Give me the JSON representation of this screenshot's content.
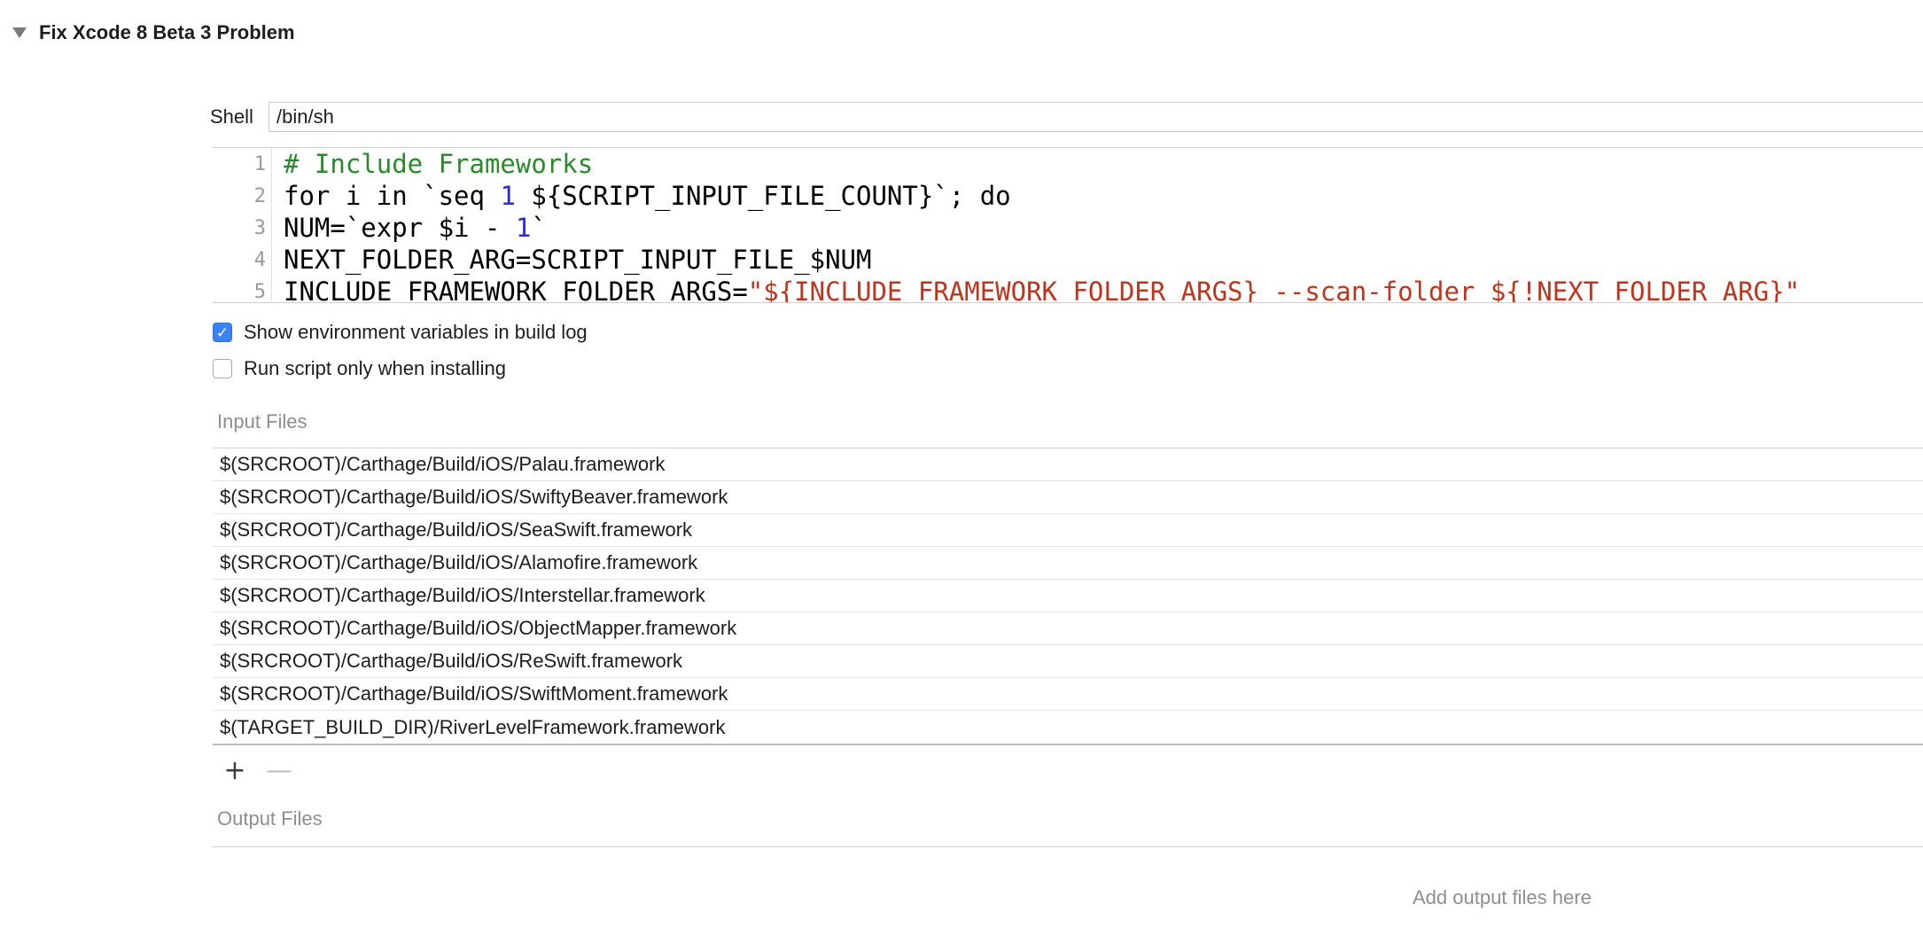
{
  "section": {
    "title": "Fix Xcode 8 Beta 3 Problem"
  },
  "shell": {
    "label": "Shell",
    "value": "/bin/sh"
  },
  "script": {
    "lines": [
      {
        "num": "1",
        "parts": [
          {
            "text": "# Include Frameworks",
            "style": "comment"
          }
        ]
      },
      {
        "num": "2",
        "parts": [
          {
            "text": "for i in `seq ",
            "style": "plain"
          },
          {
            "text": "1",
            "style": "num"
          },
          {
            "text": " ${SCRIPT_INPUT_FILE_COUNT}`; do",
            "style": "plain"
          }
        ]
      },
      {
        "num": "3",
        "parts": [
          {
            "text": "NUM=`expr $i - ",
            "style": "plain"
          },
          {
            "text": "1",
            "style": "num"
          },
          {
            "text": "`",
            "style": "plain"
          }
        ]
      },
      {
        "num": "4",
        "parts": [
          {
            "text": "NEXT_FOLDER_ARG=SCRIPT_INPUT_FILE_$NUM",
            "style": "plain"
          }
        ]
      },
      {
        "num": "5",
        "parts": [
          {
            "text": "INCLUDE_FRAMEWORK_FOLDER_ARGS=",
            "style": "plain"
          },
          {
            "text": "\"${INCLUDE_FRAMEWORK_FOLDER_ARGS} --scan-folder ${!NEXT_FOLDER_ARG}\"",
            "style": "str"
          }
        ]
      }
    ]
  },
  "options": {
    "show_env": {
      "label": "Show environment variables in build log",
      "checked": true
    },
    "run_only_installing": {
      "label": "Run script only when installing",
      "checked": false
    }
  },
  "input_files": {
    "title": "Input Files",
    "items": [
      "$(SRCROOT)/Carthage/Build/iOS/Palau.framework",
      "$(SRCROOT)/Carthage/Build/iOS/SwiftyBeaver.framework",
      "$(SRCROOT)/Carthage/Build/iOS/SeaSwift.framework",
      "$(SRCROOT)/Carthage/Build/iOS/Alamofire.framework",
      "$(SRCROOT)/Carthage/Build/iOS/Interstellar.framework",
      "$(SRCROOT)/Carthage/Build/iOS/ObjectMapper.framework",
      "$(SRCROOT)/Carthage/Build/iOS/ReSwift.framework",
      "$(SRCROOT)/Carthage/Build/iOS/SwiftMoment.framework",
      "$(TARGET_BUILD_DIR)/RiverLevelFramework.framework"
    ],
    "add_symbol": "+",
    "remove_symbol": "—"
  },
  "output_files": {
    "title": "Output Files",
    "placeholder": "Add output files here"
  },
  "icons": {
    "disclosure": "disclosure-triangle-down-icon",
    "checkmark": "checkmark-icon"
  },
  "colors": {
    "accent": "#3b82f6",
    "comment": "#2a8a2a",
    "number": "#2b2bd6",
    "string": "#c0341d"
  }
}
